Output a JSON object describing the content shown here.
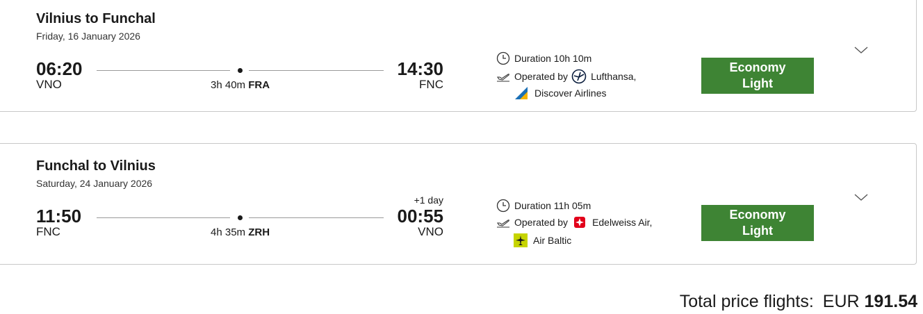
{
  "flights": [
    {
      "title": "Vilnius to Funchal",
      "date": "Friday, 16 January 2026",
      "departure_time": "06:20",
      "departure_code": "VNO",
      "arrival_time": "14:30",
      "arrival_code": "FNC",
      "day_offset": "",
      "layover_duration": "3h 40m",
      "layover_airport": "FRA",
      "duration": "Duration 10h 10m",
      "operated_by_label": "Operated by",
      "carrier_1": "Lufthansa,",
      "carrier_1_icon": "lufthansa-crane-logo",
      "carrier_2": "Discover Airlines",
      "carrier_2_icon": "discover-airlines-logo",
      "fare_line1": "Economy",
      "fare_line2": "Light"
    },
    {
      "title": "Funchal to Vilnius",
      "date": "Saturday, 24 January 2026",
      "departure_time": "11:50",
      "departure_code": "FNC",
      "arrival_time": "00:55",
      "arrival_code": "VNO",
      "day_offset": "+1 day",
      "layover_duration": "4h 35m",
      "layover_airport": "ZRH",
      "duration": "Duration 11h 05m",
      "operated_by_label": "Operated by",
      "carrier_1": "Edelweiss Air,",
      "carrier_1_icon": "edelweiss-logo",
      "carrier_2": "Air Baltic",
      "carrier_2_icon": "airbaltic-logo",
      "fare_line1": "Economy",
      "fare_line2": "Light"
    }
  ],
  "total": {
    "label": "Total price flights:",
    "currency": "EUR",
    "amount": "191.54"
  },
  "colors": {
    "fare_button": "#3e8434",
    "card_border": "#c8c8c8",
    "lufthansa": "#0a1d3d",
    "discover": "#1a6fb5",
    "edelweiss": "#e2001a",
    "airbaltic": "#c6d400"
  }
}
